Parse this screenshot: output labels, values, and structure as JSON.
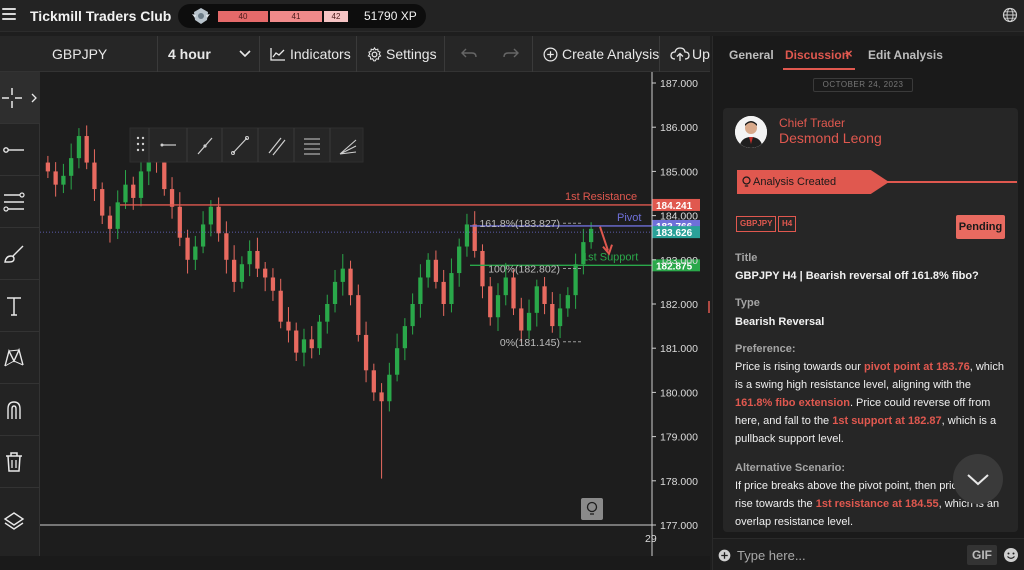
{
  "app": {
    "title": "Tickmill Traders Club"
  },
  "xp": {
    "level_prev": "40",
    "level_current": "41",
    "level_next": "42",
    "points_label": "51790 XP"
  },
  "toolbar": {
    "symbol": "GBPJPY",
    "interval": "4 hour",
    "indicators_label": "Indicators",
    "settings_label": "Settings",
    "create_label": "Create Analysis",
    "upload_label": "Up"
  },
  "chart_data": {
    "type": "candlestick",
    "symbol": "GBPJPY",
    "timeframe": "H4",
    "y_axis": {
      "ticks": [
        "187.000",
        "186.000",
        "185.000",
        "184.000",
        "183.000",
        "182.000",
        "181.000",
        "180.000",
        "179.000",
        "178.000",
        "177.000"
      ],
      "range": [
        177.0,
        187.0
      ]
    },
    "x_axis": {
      "ticks": [
        "29"
      ]
    },
    "price_labels": [
      {
        "value": 184.241,
        "text": "184.241",
        "color": "#e0584f"
      },
      {
        "value": 183.766,
        "text": "183.766",
        "color": "#6f70d9"
      },
      {
        "value": 183.626,
        "text": "183.626",
        "color": "#2aa198"
      },
      {
        "value": 182.875,
        "text": "182.875",
        "color": "#2aa84a"
      }
    ],
    "levels": [
      {
        "name": "1st Resistance",
        "value": 184.241,
        "color": "#e0584f"
      },
      {
        "name": "Pivot",
        "value": 183.766,
        "color": "#6f70d9"
      },
      {
        "name": "1st Support",
        "value": 182.875,
        "color": "#2aa84a"
      }
    ],
    "fib_levels": [
      {
        "label": "161.8%(183.827)",
        "value": 183.827
      },
      {
        "label": "100%(182.802)",
        "value": 182.802
      },
      {
        "label": "0%(181.145)",
        "value": 181.145
      }
    ],
    "close_series": [
      185.0,
      184.7,
      184.9,
      185.3,
      185.8,
      185.2,
      184.6,
      184.0,
      183.7,
      184.3,
      184.7,
      184.4,
      185.0,
      185.6,
      185.2,
      184.6,
      184.2,
      183.5,
      183.0,
      183.3,
      183.8,
      184.2,
      183.6,
      183.0,
      182.5,
      182.9,
      183.2,
      182.8,
      182.6,
      182.3,
      181.6,
      181.4,
      180.9,
      181.2,
      181.0,
      181.6,
      182.0,
      182.5,
      182.8,
      182.2,
      181.3,
      180.5,
      180.0,
      179.8,
      180.4,
      181.0,
      181.5,
      182.0,
      182.6,
      183.0,
      182.5,
      182.0,
      182.7,
      183.3,
      183.8,
      183.2,
      182.4,
      181.7,
      182.2,
      182.6,
      181.9,
      181.4,
      181.8,
      182.4,
      182.0,
      181.5,
      181.9,
      182.2,
      182.9,
      183.4,
      183.7
    ]
  },
  "panel": {
    "tabs": [
      "General",
      "Discussion",
      "Edit Analysis"
    ],
    "date": "OCTOBER 24, 2023",
    "author_role": "Chief Trader",
    "author_name": "Desmond Leong",
    "banner": "Analysis Created",
    "tag_symbol": "GBPJPY",
    "tag_tf": "H4",
    "status": "Pending",
    "title_label": "Title",
    "title_value": "GBPJPY H4 | Bearish reversal off 161.8% fibo?",
    "type_label": "Type",
    "type_value": "Bearish Reversal",
    "pref_label": "Preference:",
    "pref_1": "Price is rising towards our ",
    "pref_hl_1": "pivot point at 183.76",
    "pref_2": ", which is a swing high resistance level, aligning with the ",
    "pref_hl_2": "161.8% fibo extension",
    "pref_3": ". Price could reverse off from here, and fall to the ",
    "pref_hl_3": "1st support at 182.87",
    "pref_4": ", which is a pullback support level.",
    "alt_label": "Alternative Scenario:",
    "alt_1": "If price breaks above the pivot point, then price could rise towards the ",
    "alt_hl_1": "1st resistance at 184.55",
    "alt_2": ", which is an overlap resistance level.",
    "input_placeholder": "Type here...",
    "gif_label": "GIF"
  },
  "colors": {
    "accent": "#e0584f",
    "bull": "#2aa84a",
    "bear": "#e86a60"
  }
}
